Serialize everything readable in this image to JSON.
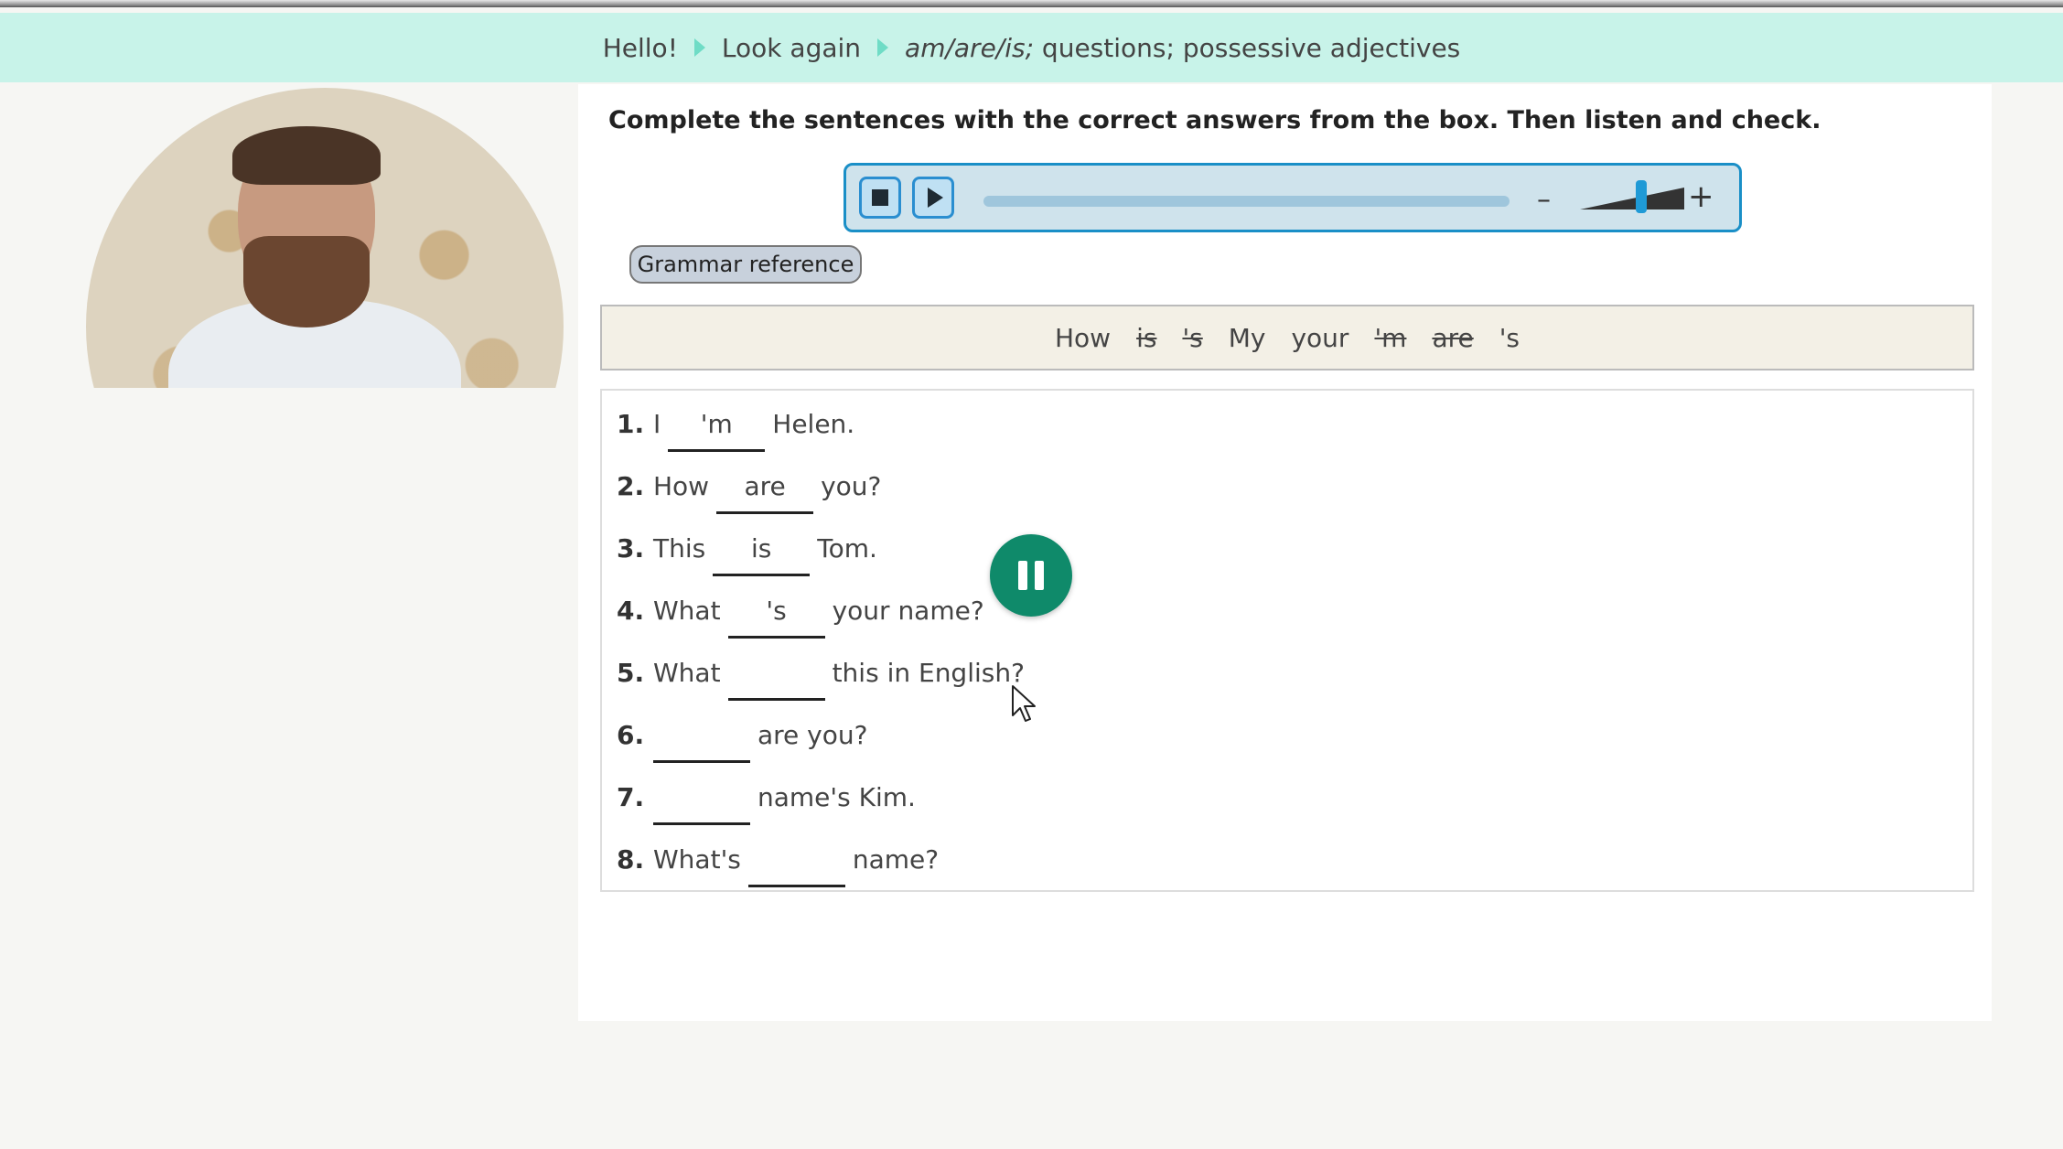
{
  "breadcrumb": {
    "items": [
      "Hello!",
      "Look again"
    ],
    "last_italic": "am/are/is;",
    "last_rest": " questions; possessive adjectives"
  },
  "instructions": "Complete the sentences with the correct answers from the box. Then listen and check.",
  "audio_player": {
    "stop_icon": "stop-icon",
    "play_icon": "play-icon",
    "volume_minus": "–",
    "volume_plus": "+",
    "volume_level": 0.55,
    "accent": "#1a8fc7"
  },
  "grammar_button": "Grammar reference",
  "word_box": [
    {
      "text": "How",
      "used": false
    },
    {
      "text": "is",
      "used": true
    },
    {
      "text": "'s",
      "used": true
    },
    {
      "text": "My",
      "used": false
    },
    {
      "text": "your",
      "used": false
    },
    {
      "text": "'m",
      "used": true
    },
    {
      "text": "are",
      "used": true
    },
    {
      "text": "'s",
      "used": false
    }
  ],
  "items": [
    {
      "num": "1.",
      "before": "I",
      "answer": "'m",
      "after": "Helen."
    },
    {
      "num": "2.",
      "before": "How",
      "answer": "are",
      "after": "you?"
    },
    {
      "num": "3.",
      "before": "This",
      "answer": "is",
      "after": "Tom."
    },
    {
      "num": "4.",
      "before": "What",
      "answer": "'s",
      "after": "your name?"
    },
    {
      "num": "5.",
      "before": "What",
      "answer": "",
      "after": "this in English?"
    },
    {
      "num": "6.",
      "before": "",
      "answer": "",
      "after": "are you?"
    },
    {
      "num": "7.",
      "before": "",
      "answer": "",
      "after": "name's Kim."
    },
    {
      "num": "8.",
      "before": "What's",
      "answer": "",
      "after": "name?"
    }
  ],
  "pause_button": {
    "icon": "pause-icon",
    "color": "#0f8a6a"
  },
  "colors": {
    "breadcrumb_bg": "#c8f3e9",
    "word_box_bg": "#f3f0e6"
  }
}
